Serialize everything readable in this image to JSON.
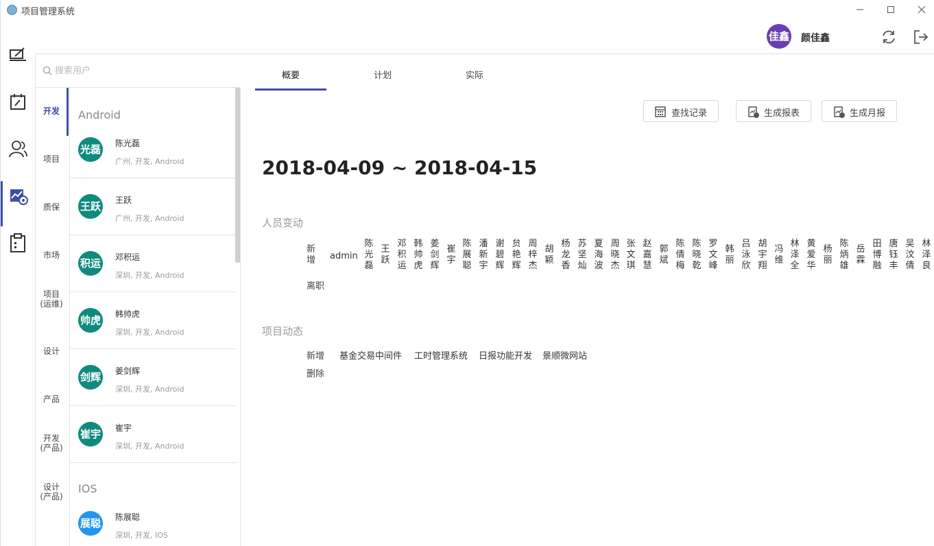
{
  "app": {
    "title": "项目管理系统"
  },
  "header": {
    "user_avatar_text": "佳鑫",
    "user_name": "颜佳鑫"
  },
  "search": {
    "placeholder": "搜索用户"
  },
  "categories": [
    "开发",
    "项目",
    "质保",
    "市场",
    "项目\n(运维)",
    "设计",
    "产品",
    "开发\n(产品)",
    "设计\n(产品)"
  ],
  "groups": [
    {
      "title": "Android",
      "users": [
        {
          "avatar": "光磊",
          "name": "陈光磊",
          "meta": "广州, 开发, Android"
        },
        {
          "avatar": "王跃",
          "name": "王跃",
          "meta": "广州, 开发, Android"
        },
        {
          "avatar": "积运",
          "name": "邓积运",
          "meta": "深圳, 开发, Android"
        },
        {
          "avatar": "帅虎",
          "name": "韩帅虎",
          "meta": "深圳, 开发, Android"
        },
        {
          "avatar": "剑辉",
          "name": "姜剑辉",
          "meta": "深圳, 开发, Android"
        },
        {
          "avatar": "崔宇",
          "name": "崔宇",
          "meta": "深圳, 开发, Android"
        }
      ]
    },
    {
      "title": "IOS",
      "users": [
        {
          "avatar": "展聪",
          "name": "陈展聪",
          "meta": "深圳, 开发, IOS"
        }
      ]
    }
  ],
  "tabs": [
    "概要",
    "计划",
    "实际"
  ],
  "buttons": {
    "find_records": "查找记录",
    "gen_report": "生成报表",
    "gen_monthly": "生成月报"
  },
  "date_range": "2018-04-09 ~ 2018-04-15",
  "personnel": {
    "title": "人员变动",
    "added_label": "新增",
    "removed_label": "离职",
    "added_admin": "admin",
    "added": [
      "陈光磊",
      "王跃",
      "邓积运",
      "韩帅虎",
      "姜剑辉",
      "崔宇",
      "陈展聪",
      "潘新宇",
      "谢碧辉",
      "贠艳辉",
      "周梓杰",
      "胡颖",
      "杨龙香",
      "苏坚灿",
      "夏海波",
      "周晓杰",
      "张文琪",
      "赵嘉慧",
      "郭斌",
      "陈倩梅",
      "陈晓乾",
      "罗文峰",
      "韩丽",
      "吕泳欣",
      "胡宇翔",
      "冯维",
      "林泽全",
      "黄爱华",
      "杨丽",
      "陈炳雄",
      "岳霖",
      "田博融",
      "唐钰丰",
      "吴汶倩",
      "林泽良"
    ]
  },
  "projects": {
    "title": "项目动态",
    "added_label": "新增",
    "removed_label": "删除",
    "added": [
      "基金交易中间件",
      "工时管理系统",
      "日报功能开发",
      "景顺微网站"
    ]
  },
  "colors": {
    "accent": "#3d4fa6",
    "avatar_teal": "#0e8b7e",
    "avatar_blue": "#2196f3",
    "user_avatar": "#6a3fb3"
  }
}
